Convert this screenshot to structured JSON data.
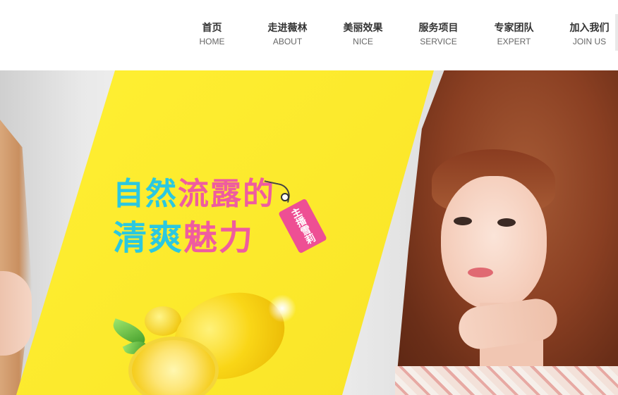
{
  "nav": [
    {
      "cn": "首页",
      "en": "HOME"
    },
    {
      "cn": "走进薇林",
      "en": "ABOUT"
    },
    {
      "cn": "美丽效果",
      "en": "NICE"
    },
    {
      "cn": "服务项目",
      "en": "SERVICE"
    },
    {
      "cn": "专家团队",
      "en": "EXPERT"
    },
    {
      "cn": "加入我们",
      "en": "JOIN US"
    }
  ],
  "banner": {
    "line1_a": "自然",
    "line1_b": "流露的",
    "line2_a": "清爽",
    "line2_b": "魅力",
    "tag": "主播雪莉"
  },
  "colors": {
    "yellow": "#fbe72a",
    "cyan": "#2bc8df",
    "pink": "#ef5c9f",
    "tag": "#ee4f94"
  }
}
